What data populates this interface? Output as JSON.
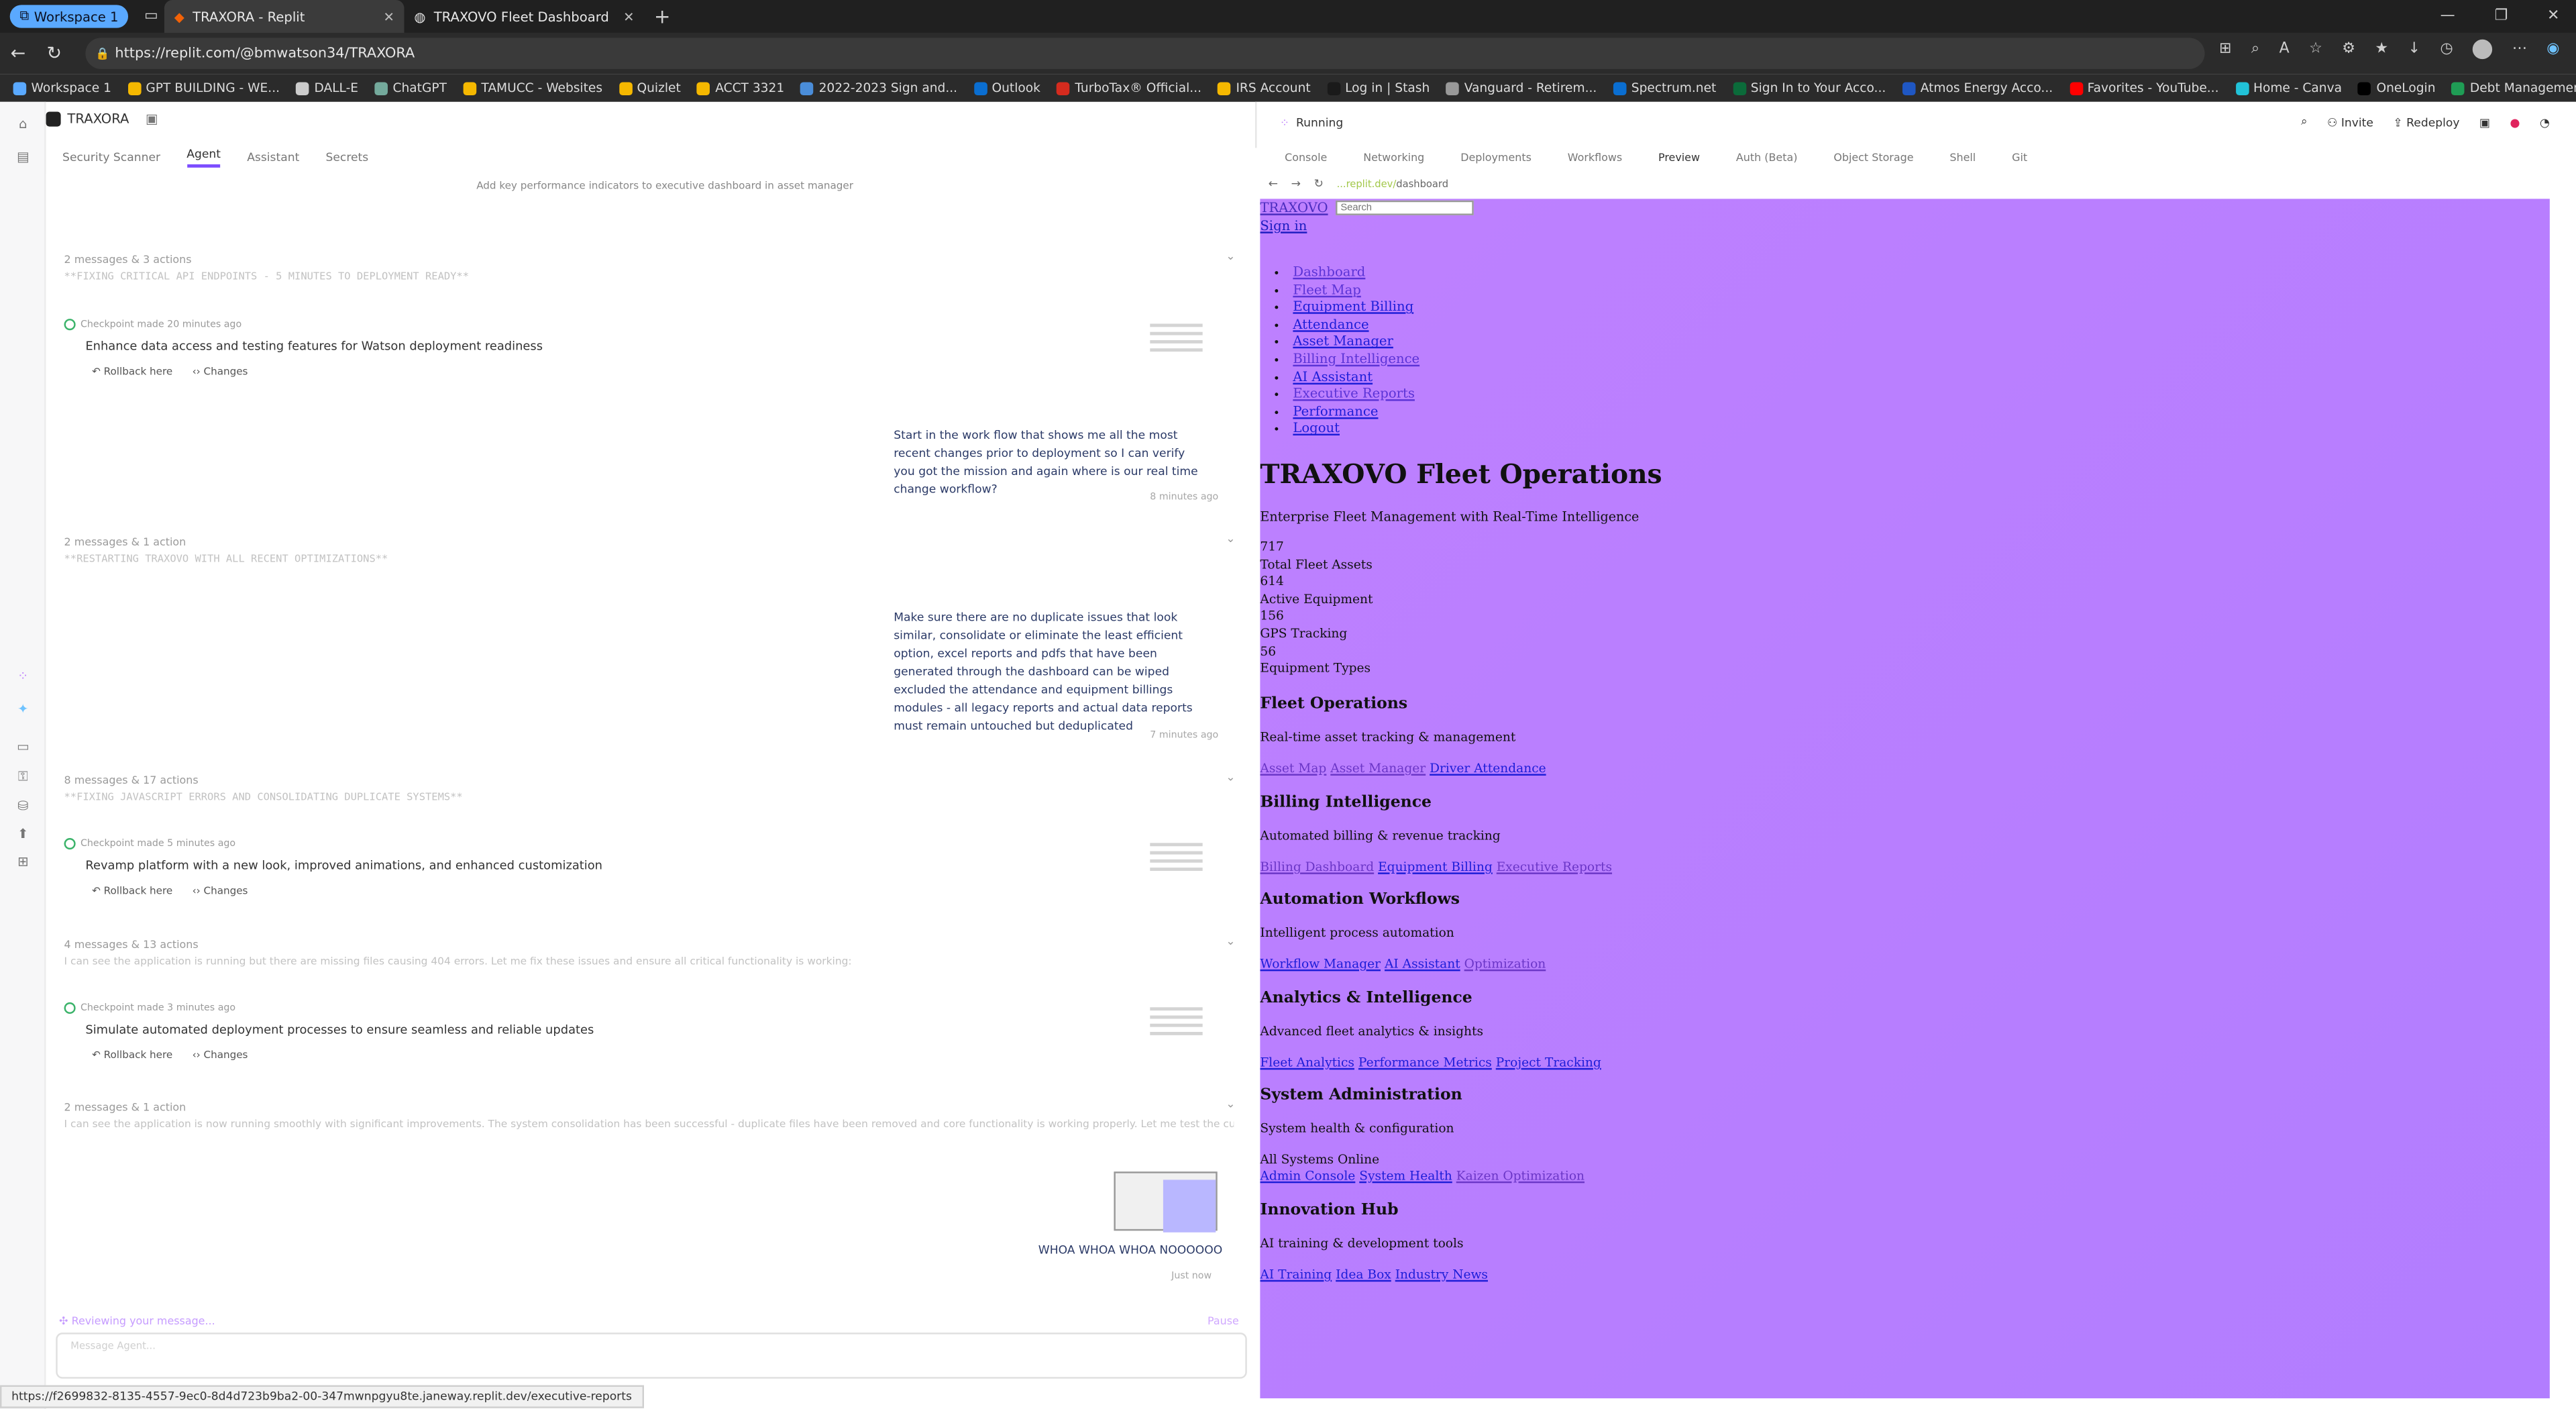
{
  "browser": {
    "workspace_chip": "Workspace 1",
    "tabs": [
      {
        "title": "TRAXORA - Replit"
      },
      {
        "title": "TRAXOVO Fleet Dashboard"
      }
    ],
    "url": "https://replit.com/@bmwatson34/TRAXORA",
    "bookmarks": [
      "Workspace 1",
      "GPT BUILDING - WE...",
      "DALL-E",
      "ChatGPT",
      "TAMUCC - Websites",
      "Quizlet",
      "ACCT 3321",
      "2022-2023 Sign and...",
      "Outlook",
      "TurboTax® Official...",
      "IRS Account",
      "Log in | Stash",
      "Vanguard - Retirem...",
      "Spectrum.net",
      "Sign In to Your Acco...",
      "Atmos Energy Acco...",
      "Favorites - YouTube...",
      "Home - Canva",
      "OneLogin",
      "Debt Management:..."
    ],
    "status_url": "https://f2699832-8135-4557-9ec0-8d4d723b9ba2-00-347mwnpgyu8te.janeway.replit.dev/executive-reports"
  },
  "app": {
    "project": "TRAXORA",
    "subtabs": [
      "Security Scanner",
      "Agent",
      "Assistant",
      "Secrets"
    ],
    "running": "Running",
    "invite": "Invite",
    "redeploy": "Redeploy",
    "preview_tabs": [
      "Console",
      "Networking",
      "Deployments",
      "Workflows",
      "Preview",
      "Auth (Beta)",
      "Object Storage",
      "Shell",
      "Git"
    ],
    "preview_url_prefix": "...replit.dev/",
    "preview_url_path": "dashboard"
  },
  "chat": {
    "top_hint": "Add key performance indicators to executive dashboard in asset manager",
    "groups": [
      {
        "summary": "2 messages & 3 actions",
        "subtitle": "**FIXING CRITICAL API ENDPOINTS - 5 MINUTES TO DEPLOYMENT READY**"
      },
      {
        "summary": "2 messages & 1 action",
        "subtitle": "**RESTARTING TRAXOVO WITH ALL RECENT OPTIMIZATIONS**"
      },
      {
        "summary": "8 messages & 17 actions",
        "subtitle": "**FIXING JAVASCRIPT ERRORS AND CONSOLIDATING DUPLICATE SYSTEMS**"
      },
      {
        "summary": "4 messages & 13 actions",
        "subtitle": "I can see the application is running but there are missing files causing 404 errors. Let me fix these issues and ensure all critical functionality is working:"
      },
      {
        "summary": "2 messages & 1 action",
        "subtitle": "I can see the application is now running smoothly with significant improvements. The system consolidation has been successful - duplicate files have been removed and core functionality is working properly. Let me test the current..."
      }
    ],
    "checkpoints": [
      {
        "meta": "Checkpoint made 20 minutes ago",
        "title": "Enhance data access and testing features for Watson deployment readiness"
      },
      {
        "meta": "Checkpoint made 5 minutes ago",
        "title": "Revamp platform with a new look, improved animations, and enhanced customization"
      },
      {
        "meta": "Checkpoint made 3 minutes ago",
        "title": "Simulate automated deployment processes to ensure seamless and reliable updates"
      }
    ],
    "rollback_label": "Rollback here",
    "changes_label": "Changes",
    "user_messages": [
      {
        "text": "Start in the work flow that shows me all the most recent changes prior to deployment so I can verify you got the mission and again where is our real time change workflow?",
        "time": "8 minutes ago"
      },
      {
        "text": "Make sure there are no duplicate issues that look similar, consolidate or eliminate the least efficient option, excel reports and pdfs that have been generated through the dashboard can be wiped excluded the attendance and equipment billings modules - all legacy reports and actual data reports must remain untouched but deduplicated",
        "time": "7 minutes ago"
      }
    ],
    "last_message": "WHOA WHOA WHOA NOOOOOO",
    "last_time": "Just now",
    "reviewing": "Reviewing your message...",
    "pause": "Pause",
    "input_placeholder": "Message Agent..."
  },
  "preview": {
    "brand": "TRAXOVO",
    "search_placeholder": "Search",
    "sign_in": "Sign in",
    "nav": [
      "Dashboard",
      "Fleet Map",
      "Equipment Billing",
      "Attendance",
      "Asset Manager",
      "Billing Intelligence",
      "AI Assistant",
      "Executive Reports",
      "Performance",
      "Logout"
    ],
    "title": "TRAXOVO Fleet Operations",
    "subtitle": "Enterprise Fleet Management with Real-Time Intelligence",
    "stats": [
      {
        "value": "717",
        "label": "Total Fleet Assets"
      },
      {
        "value": "614",
        "label": "Active Equipment"
      },
      {
        "value": "156",
        "label": "GPS Tracking"
      },
      {
        "value": "56",
        "label": "Equipment Types"
      }
    ],
    "sections": [
      {
        "title": "Fleet Operations",
        "desc": "Real-time asset tracking & management",
        "links": [
          "Asset Map",
          "Asset Manager",
          "Driver Attendance"
        ]
      },
      {
        "title": "Billing Intelligence",
        "desc": "Automated billing & revenue tracking",
        "links": [
          "Billing Dashboard",
          "Equipment Billing",
          "Executive Reports"
        ]
      },
      {
        "title": "Automation Workflows",
        "desc": "Intelligent process automation",
        "links": [
          "Workflow Manager",
          "AI Assistant",
          "Optimization"
        ]
      },
      {
        "title": "Analytics & Intelligence",
        "desc": "Advanced fleet analytics & insights",
        "links": [
          "Fleet Analytics",
          "Performance Metrics",
          "Project Tracking"
        ]
      },
      {
        "title": "System Administration",
        "desc": "System health & configuration",
        "status": "All Systems Online",
        "links": [
          "Admin Console",
          "System Health",
          "Kaizen Optimization"
        ]
      },
      {
        "title": "Innovation Hub",
        "desc": "AI training & development tools",
        "links": [
          "AI Training",
          "Idea Box",
          "Industry News"
        ]
      }
    ]
  }
}
